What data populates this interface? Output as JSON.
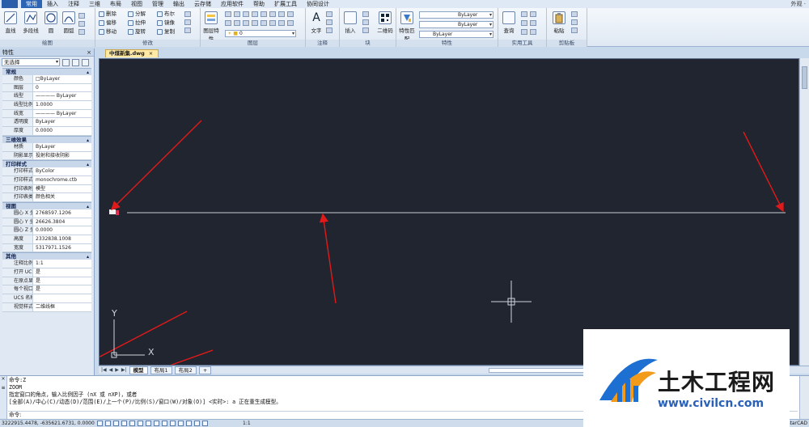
{
  "menu": {
    "items": [
      "常用",
      "插入",
      "注释",
      "三维",
      "布局",
      "视图",
      "管理",
      "输出",
      "云存储",
      "应用软件",
      "帮助",
      "扩展工具",
      "协同设计"
    ],
    "active_index": 0,
    "right_label": "外观 ·"
  },
  "ribbon": {
    "draw": {
      "label": "绘图",
      "line": "直线",
      "polyline": "多段线",
      "circle": "圆",
      "arc": "圆弧"
    },
    "modify": {
      "label": "修改",
      "tools": [
        "删除",
        "分解",
        "布尔",
        "偏移",
        "拉伸",
        "镜像",
        "移动",
        "旋转",
        "复制"
      ]
    },
    "layers": {
      "label": "图层",
      "layer_props": "图层特性",
      "current_layer": "0"
    },
    "annotation": {
      "label": "注释",
      "text": "文字"
    },
    "block": {
      "label": "块",
      "insert": "插入",
      "qr": "二维码"
    },
    "properties": {
      "label": "特性",
      "match": "特性匹配",
      "color": "ByLayer",
      "linetype": "ByLayer",
      "lineweight": "ByLayer"
    },
    "utilities": {
      "label": "实用工具",
      "query": "查询"
    },
    "clipboard": {
      "label": "剪贴板",
      "paste": "粘贴"
    }
  },
  "properties_panel": {
    "title": "特性",
    "close": "×",
    "selection": "无选择",
    "sections": [
      {
        "name": "常规",
        "rows": [
          {
            "k": "颜色",
            "v": "□ByLayer"
          },
          {
            "k": "图层",
            "v": "0"
          },
          {
            "k": "线型",
            "v": "———— ByLayer"
          },
          {
            "k": "线型比例",
            "v": "1.0000"
          },
          {
            "k": "线宽",
            "v": "———— ByLayer"
          },
          {
            "k": "透明度",
            "v": "ByLayer"
          },
          {
            "k": "厚度",
            "v": "0.0000"
          }
        ]
      },
      {
        "name": "三维效果",
        "rows": [
          {
            "k": "材质",
            "v": "ByLayer"
          },
          {
            "k": "阴影显示",
            "v": "投射和接收阴影"
          }
        ]
      },
      {
        "name": "打印样式",
        "rows": [
          {
            "k": "打印样式",
            "v": "ByColor"
          },
          {
            "k": "打印样式表",
            "v": "monochrome.ctb"
          },
          {
            "k": "打印表附...",
            "v": "模型"
          },
          {
            "k": "打印表类型",
            "v": "颜色相关"
          }
        ]
      },
      {
        "name": "视图",
        "rows": [
          {
            "k": "圆心 X 坐标",
            "v": "2768597.1206"
          },
          {
            "k": "圆心 Y 坐标",
            "v": "26626.3804"
          },
          {
            "k": "圆心 Z 坐标",
            "v": "0.0000"
          },
          {
            "k": "高度",
            "v": "2332838.1008"
          },
          {
            "k": "宽度",
            "v": "5317971.1526"
          }
        ]
      },
      {
        "name": "其他",
        "rows": [
          {
            "k": "注释比例",
            "v": "1:1"
          },
          {
            "k": "打开 UCS...",
            "v": "是"
          },
          {
            "k": "在原点显...",
            "v": "是"
          },
          {
            "k": "每个视口...",
            "v": "是"
          },
          {
            "k": "UCS 名称",
            "v": ""
          },
          {
            "k": "视觉样式",
            "v": "二维线框"
          }
        ]
      }
    ]
  },
  "document": {
    "tab_label": "中煤新集.dwg",
    "close": "×"
  },
  "layout_tabs": [
    "模型",
    "布局1",
    "布局2",
    "+"
  ],
  "command": {
    "history": [
      "命令:Z",
      "ZOOM",
      "指定窗口的角点，输入比例因子 (nX 或 nXP)，或者",
      "[全部(A)/中心(C)/动态(D)/范围(E)/上一个(P)/比例(S)/窗口(W)/对象(O)] <实时>: a 正在重生成模型。"
    ],
    "prompt": "命令:"
  },
  "status": {
    "coords": "3222915.4478, -635621.6731, 0.0000",
    "scale": "1:1",
    "brand": "ZstarCAD"
  },
  "canvas": {
    "ucs_x": "X",
    "ucs_y": "Y",
    "annotation_color": "#e01a1a",
    "line_color": "#c9ced6"
  },
  "watermark": {
    "name": "土木工程网",
    "url": "www.civilcn.com"
  }
}
